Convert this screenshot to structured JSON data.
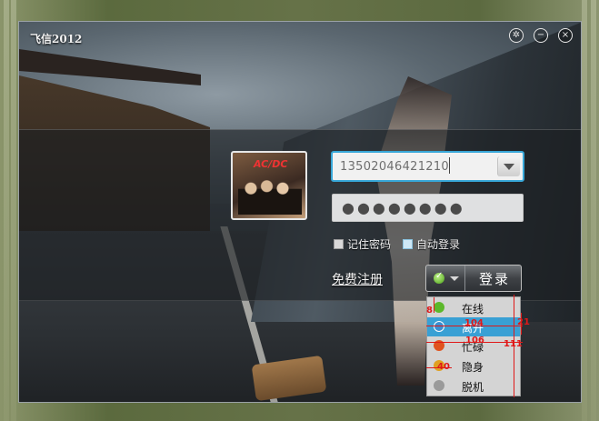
{
  "window": {
    "title": "飞信2012",
    "sys_buttons": [
      "settings-icon",
      "minimize-icon",
      "close-icon"
    ]
  },
  "login": {
    "account_value": "13502046421210",
    "password_mask": "●●●●●●●●",
    "remember_password_label": "记住密码",
    "auto_login_label": "自动登录",
    "register_link": "免费注册",
    "login_button": "登录"
  },
  "status_menu": {
    "items": [
      {
        "label": "在线",
        "icon": "online-icon",
        "color": "#5cb82b"
      },
      {
        "label": "离开",
        "icon": "away-icon",
        "color": "#3a8fd0"
      },
      {
        "label": "忙碌",
        "icon": "busy-icon",
        "color": "#e0531e"
      },
      {
        "label": "隐身",
        "icon": "invisible-icon",
        "color": "#e0a020"
      },
      {
        "label": "脱机",
        "icon": "offline-icon",
        "color": "#9a9a9a"
      }
    ],
    "selected_index": 1
  },
  "measurements": {
    "a": "8",
    "b": "104",
    "c": "21",
    "d": "106",
    "e": "111",
    "f": "40"
  },
  "colors": {
    "accent": "#38a7d8",
    "measure": "#e01818"
  }
}
